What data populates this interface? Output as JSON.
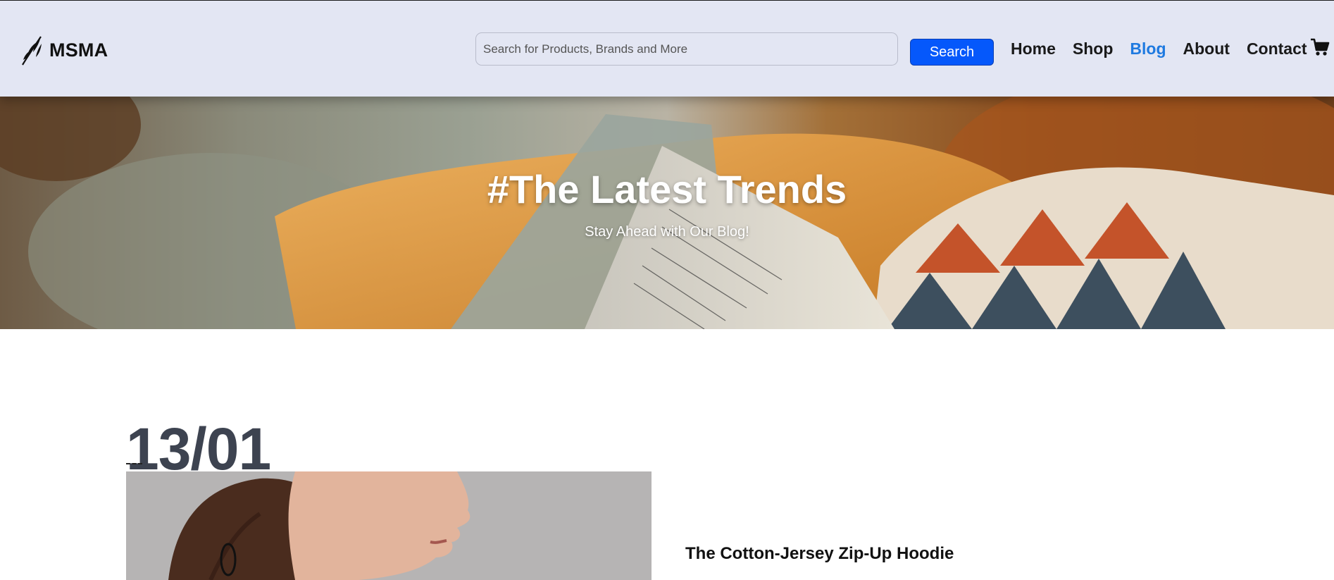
{
  "header": {
    "logo_text": "MSMA",
    "search_placeholder": "Search for Products, Brands and More",
    "search_button_label": "Search",
    "nav": [
      {
        "label": "Home"
      },
      {
        "label": "Shop"
      },
      {
        "label": "Blog"
      },
      {
        "label": "About"
      },
      {
        "label": "Contact"
      }
    ],
    "active_nav": "Blog",
    "cart_icon": "cart-icon"
  },
  "hero": {
    "title": "#The Latest Trends",
    "subtitle": "Stay Ahead with Our Blog!"
  },
  "blog": {
    "post": {
      "date": "13/01",
      "title": "The Cotton-Jersey Zip-Up Hoodie",
      "excerpt": ""
    }
  },
  "colors": {
    "header_bg": "#e3e6f3",
    "search_button": "#0558fb",
    "active_nav": "#1f7ae0",
    "date_text": "#3d4350"
  }
}
